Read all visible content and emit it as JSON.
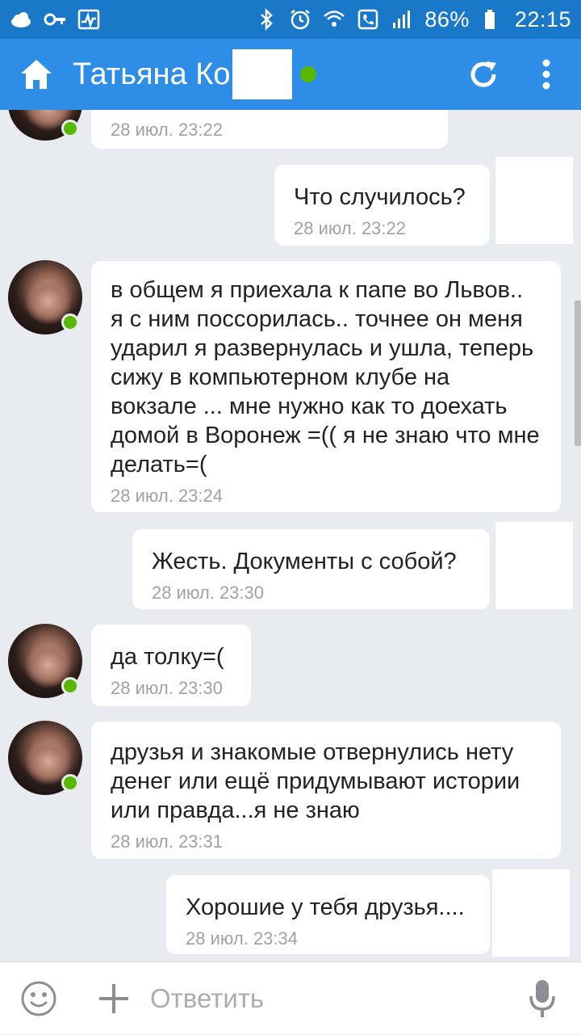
{
  "status_bar": {
    "battery_text": "86%",
    "time": "22:15"
  },
  "header": {
    "title": "Татьяна Ко",
    "icons": [
      "home-icon",
      "refresh-icon",
      "more-vertical-icon"
    ]
  },
  "messages": [
    {
      "from": "contact",
      "text": "",
      "time": "28 июл. 23:22"
    },
    {
      "from": "me",
      "text": "Что случилось?",
      "time": "28 июл. 23:22"
    },
    {
      "from": "contact",
      "text": "в общем я приехала к папе во Львов.. я с ним поссорилась.. точнее он меня ударил я развернулась и ушла, теперь сижу в компьютерном клубе на вокзале ... мне нужно как то доехать домой в Воронеж =(( я не знаю что мне делать=(",
      "time": "28 июл. 23:24"
    },
    {
      "from": "me",
      "text": "Жесть. Документы с собой?",
      "time": "28 июл. 23:30"
    },
    {
      "from": "contact",
      "text": "да толку=(",
      "time": "28 июл. 23:30"
    },
    {
      "from": "contact",
      "text": "друзья и знакомые отвернулись нету денег или ещё придумывают истории или правда...я не знаю",
      "time": "28 июл. 23:31"
    },
    {
      "from": "me",
      "text": "Хорошие у тебя друзья....",
      "time": "28 июл. 23:34"
    }
  ],
  "composer": {
    "placeholder": "Ответить"
  },
  "colors": {
    "status_bar": "#1a78c9",
    "app_bar": "#2e8ee7",
    "online": "#58b800",
    "chat_background": "#e8ebf0"
  }
}
